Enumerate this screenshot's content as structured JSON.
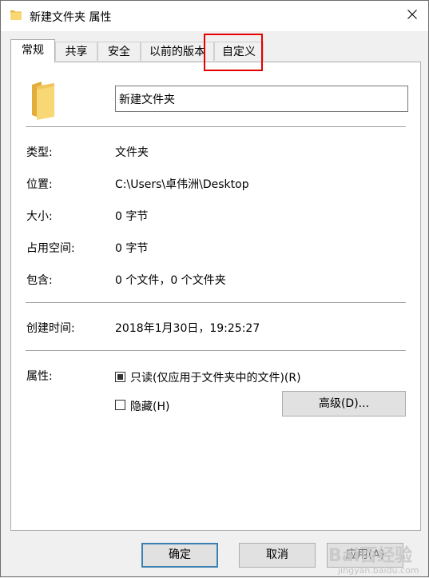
{
  "window": {
    "title": "新建文件夹 属性"
  },
  "tabs": [
    {
      "label": "常规",
      "active": true
    },
    {
      "label": "共享"
    },
    {
      "label": "安全"
    },
    {
      "label": "以前的版本"
    },
    {
      "label": "自定义"
    }
  ],
  "general": {
    "folder_name": "新建文件夹",
    "type_label": "类型:",
    "type_value": "文件夹",
    "location_label": "位置:",
    "location_value": "C:\\Users\\卓伟洲\\Desktop",
    "size_label": "大小:",
    "size_value": "0 字节",
    "size_on_disk_label": "占用空间:",
    "size_on_disk_value": "0 字节",
    "contains_label": "包含:",
    "contains_value": "0 个文件，0 个文件夹",
    "created_label": "创建时间:",
    "created_value": "2018年1月30日，19:25:27",
    "attributes_label": "属性:",
    "readonly_label": "只读(仅应用于文件夹中的文件)(R)",
    "readonly_state": "indeterminate",
    "hidden_label": "隐藏(H)",
    "hidden_checked": false,
    "advanced_label": "高级(D)..."
  },
  "footer": {
    "ok_label": "确定",
    "cancel_label": "取消",
    "apply_label": "应用(A)"
  },
  "annotation": {
    "highlight_color": "#e60000"
  },
  "watermark": {
    "logo": "Bai百经验",
    "sub": "jingyan.baidu.com"
  },
  "colors": {
    "folder_yellow": "#f8d775",
    "accent": "#3c7fb1"
  }
}
